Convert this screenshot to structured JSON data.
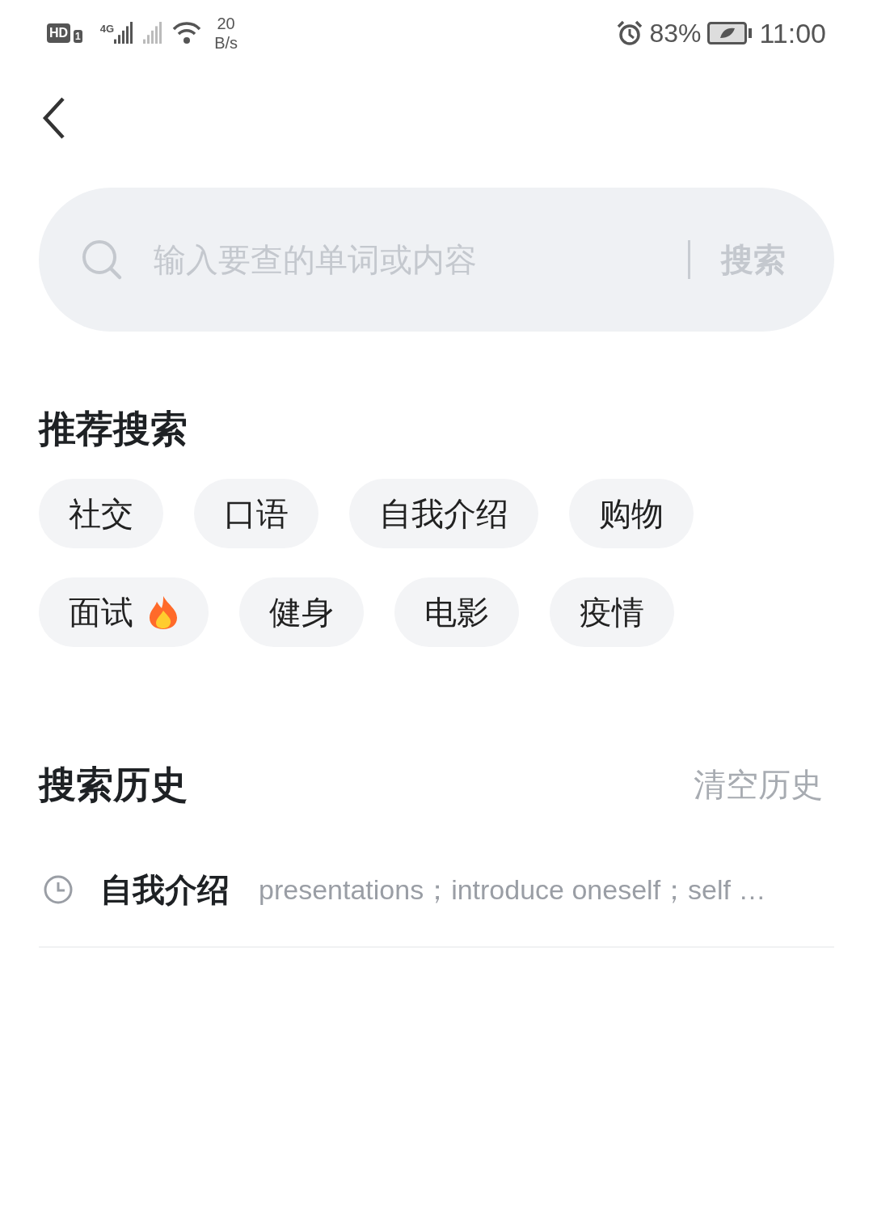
{
  "status_bar": {
    "hd_badge": "HD",
    "sim_slot": "1",
    "network": "4G",
    "speed": "20",
    "speed_unit": "B/s",
    "battery": "83%",
    "time": "11:00"
  },
  "search": {
    "placeholder": "输入要查的单词或内容",
    "button": "搜索"
  },
  "recommended": {
    "title": "推荐搜索",
    "tags": [
      {
        "label": "社交",
        "hot": false
      },
      {
        "label": "口语",
        "hot": false
      },
      {
        "label": "自我介绍",
        "hot": false
      },
      {
        "label": "购物",
        "hot": false
      },
      {
        "label": "面试",
        "hot": true
      },
      {
        "label": "健身",
        "hot": false
      },
      {
        "label": "电影",
        "hot": false
      },
      {
        "label": "疫情",
        "hot": false
      }
    ]
  },
  "history": {
    "title": "搜索历史",
    "clear": "清空历史",
    "items": [
      {
        "word": "自我介绍",
        "meaning": "presentations；introduce oneself；self …"
      }
    ]
  }
}
